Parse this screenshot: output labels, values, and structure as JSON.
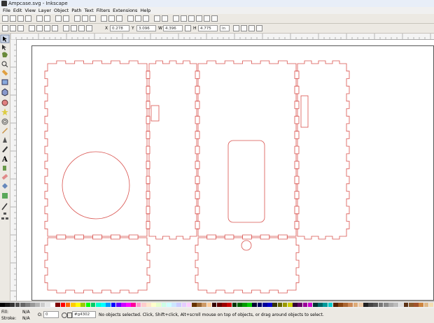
{
  "window": {
    "title": "Ampcase.svg - Inkscape"
  },
  "menu": [
    "File",
    "Edit",
    "View",
    "Layer",
    "Object",
    "Path",
    "Text",
    "Filters",
    "Extensions",
    "Help"
  ],
  "controls": {
    "x": "0.278",
    "y": "3.096",
    "w": "4.396",
    "h": "4.775",
    "unit": "in"
  },
  "status": {
    "fill_label": "Fill:",
    "fill_value": "N/A",
    "stroke_label": "Stroke:",
    "stroke_value": "N/A",
    "opacity": "0",
    "layer": "#g4302",
    "message": "No objects selected. Click, Shift+click, Alt+scroll mouse on top of objects, or drag around objects to select."
  },
  "colors": {
    "cut_line": "#d9534f",
    "canvas_bg": "#ffffff",
    "chrome": "#ece9e3"
  },
  "palette": [
    "#000000",
    "#1a1a1a",
    "#333333",
    "#4d4d4d",
    "#666666",
    "#808080",
    "#999999",
    "#b3b3b3",
    "#cccccc",
    "#e6e6e6",
    "#ffffff",
    "#800000",
    "#ff0000",
    "#ff6600",
    "#ffcc00",
    "#ffff00",
    "#99cc00",
    "#00ff00",
    "#00cc66",
    "#00ffcc",
    "#00ffff",
    "#0099ff",
    "#0000ff",
    "#6600ff",
    "#cc00ff",
    "#ff00ff",
    "#ff0099",
    "#ff99cc",
    "#ffcccc",
    "#ffe6cc",
    "#ffffcc",
    "#e6ffcc",
    "#ccffe6",
    "#ccffff",
    "#cce6ff",
    "#ccccff",
    "#e6ccff",
    "#ffccff",
    "#663300",
    "#996633",
    "#cc9966",
    "#ffcc99",
    "#330000",
    "#660000",
    "#990000",
    "#cc0000",
    "#003300",
    "#006600",
    "#009900",
    "#00cc00",
    "#000033",
    "#000066",
    "#000099",
    "#0000cc",
    "#333300",
    "#666600",
    "#999900",
    "#cccc00",
    "#330033",
    "#660066",
    "#990099",
    "#cc00cc",
    "#003333",
    "#006666",
    "#009999",
    "#00cccc",
    "#552200",
    "#884411",
    "#aa6633",
    "#cc8855",
    "#ddaa77",
    "#eeccaa",
    "#222222",
    "#444444",
    "#555555",
    "#777777",
    "#888888",
    "#aaaaaa",
    "#bbbbbb",
    "#dddddd",
    "#5c3317",
    "#8b5a2b",
    "#a0522d",
    "#cd853f",
    "#deb887",
    "#f5deb3"
  ]
}
